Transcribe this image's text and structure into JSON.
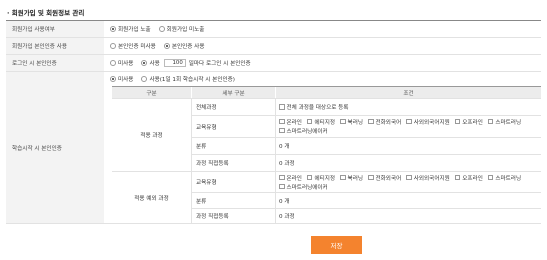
{
  "title": "· 회원가입 및 회원정보 관리",
  "rows": {
    "signup_use": {
      "label": "회원가입 사용여부",
      "options": [
        "회원가입 노출",
        "회원가입 미노출"
      ],
      "selected": 0
    },
    "signup_auth": {
      "label": "회원가입 본인인증 사용",
      "options": [
        "본인인증 미사용",
        "본인인증 사용"
      ],
      "selected": 1
    },
    "login_auth": {
      "label": "로그인 시 본인인증",
      "options": [
        "미사용",
        "사용"
      ],
      "selected": 1,
      "count": "100",
      "suffix": "일마다 로그인 시 본인인증"
    },
    "study_auth": {
      "label": "학습시작 시 본인인증",
      "options": [
        "미사용",
        "사용(1일 1회 학습시작 시 본인인증)"
      ],
      "selected": 0
    }
  },
  "table": {
    "headers": [
      "구분",
      "세부 구분",
      "조건"
    ],
    "course_apply": {
      "group": "적용 과정",
      "all_courses": {
        "label": "전체과정",
        "checkbox": "전체 과정을 대상으로 등록"
      },
      "edu_type": {
        "label": "교육유형",
        "items": [
          "온라인",
          "에티지정",
          "북러닝",
          "전화외국어",
          "사외외국어지원",
          "오프라인",
          "스마트러닝"
        ],
        "items2": [
          "스마트러닝에이커"
        ]
      },
      "category": {
        "label": "분류",
        "value": "0 개"
      },
      "course_select": {
        "label": "과정 직접등록",
        "value": "0 과정"
      }
    },
    "course_exclude": {
      "group": "적용 예외 과정",
      "edu_type": {
        "label": "교육유형",
        "items": [
          "온라인",
          "에티지정",
          "북러닝",
          "전화외국어",
          "사외외국어지원",
          "오프라인",
          "스마트러닝"
        ],
        "items2": [
          "스마트러닝에이커"
        ]
      },
      "category": {
        "label": "분류",
        "value": "0 개"
      },
      "course_select": {
        "label": "과정 직접등록",
        "value": "0 과정"
      }
    }
  },
  "save_label": "저장",
  "colors": {
    "accent": "#f4832e"
  }
}
